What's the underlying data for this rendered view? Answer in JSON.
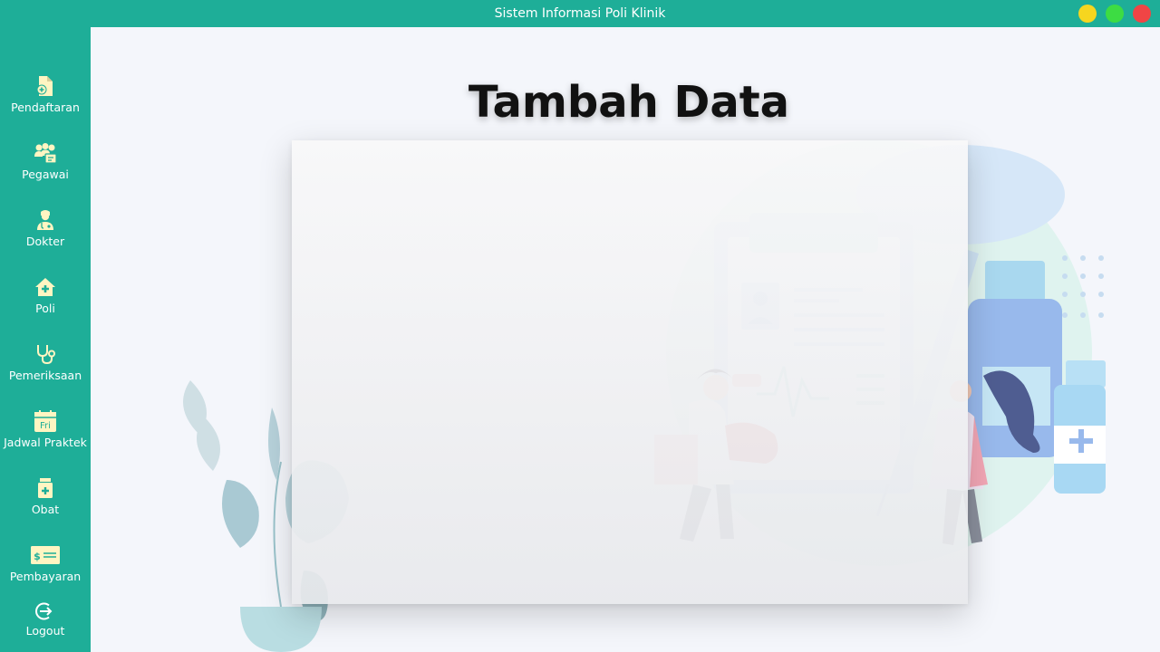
{
  "window": {
    "title": "Sistem Informasi Poli Klinik",
    "controls": [
      "minimize",
      "maximize",
      "close"
    ]
  },
  "sidebar": {
    "items": [
      {
        "label": "Pendaftaran",
        "icon": "file-add-icon"
      },
      {
        "label": "Pegawai",
        "icon": "staff-group-icon"
      },
      {
        "label": "Dokter",
        "icon": "doctor-icon"
      },
      {
        "label": "Poli",
        "icon": "clinic-house-icon"
      },
      {
        "label": "Pemeriksaan",
        "icon": "stethoscope-icon"
      },
      {
        "label": "Jadwal Praktek",
        "icon": "calendar-icon",
        "icon_text": "Fri"
      },
      {
        "label": "Obat",
        "icon": "medicine-bottle-icon"
      },
      {
        "label": "Pembayaran",
        "icon": "payment-cheque-icon"
      },
      {
        "label": "Logout",
        "icon": "logout-icon"
      }
    ]
  },
  "main": {
    "title": "Tambah Data"
  },
  "colors": {
    "accent": "#1eae98",
    "icon": "#fff5c2",
    "background": "#f4f6fb",
    "minimize": "#f6d61f",
    "maximize": "#3ddc43",
    "close": "#f04545"
  }
}
